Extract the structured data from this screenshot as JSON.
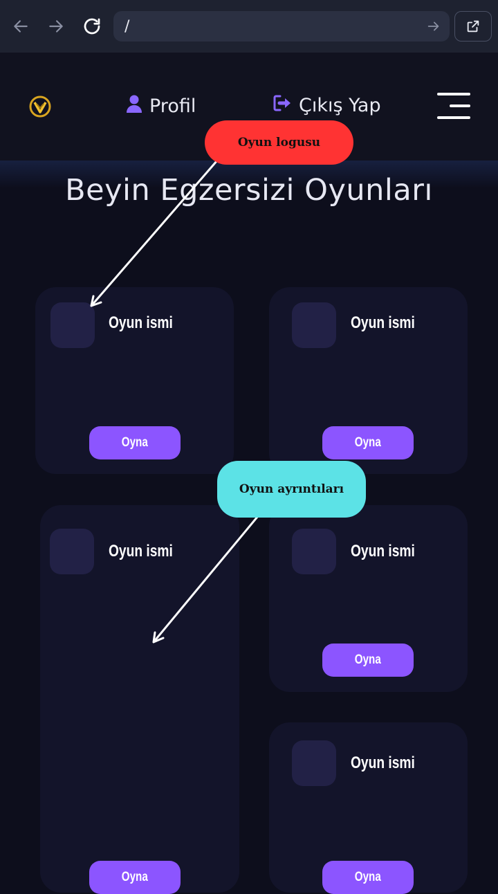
{
  "browser": {
    "url": "/",
    "icons": [
      "back-icon",
      "forward-icon",
      "reload-icon",
      "go-icon",
      "open-external-icon"
    ]
  },
  "header": {
    "profile_label": "Profil",
    "logout_label": "Çıkış Yap",
    "icons": [
      "site-logo-icon",
      "user-icon",
      "logout-icon",
      "hamburger-menu-icon"
    ]
  },
  "page": {
    "title": "Beyin Egzersizi Oyunları"
  },
  "games": [
    {
      "name": "Oyun ismi",
      "button": "Oyna"
    },
    {
      "name": "Oyun ismi",
      "button": "Oyna"
    },
    {
      "name": "Oyun ismi",
      "button": "Oyna"
    },
    {
      "name": "Oyun ismi",
      "button": "Oyna"
    },
    {
      "name": "Oyun ismi",
      "button": "Oyna"
    }
  ],
  "annotations": {
    "logo_callout": "Oyun logusu",
    "details_callout": "Oyun ayrıntıları"
  },
  "colors": {
    "background": "#0d0e1c",
    "card": "#13142a",
    "logo_placeholder": "#222146",
    "accent": "#8c55ff",
    "logo_callout": "#ff3333",
    "details_callout": "#5ce2e6"
  }
}
